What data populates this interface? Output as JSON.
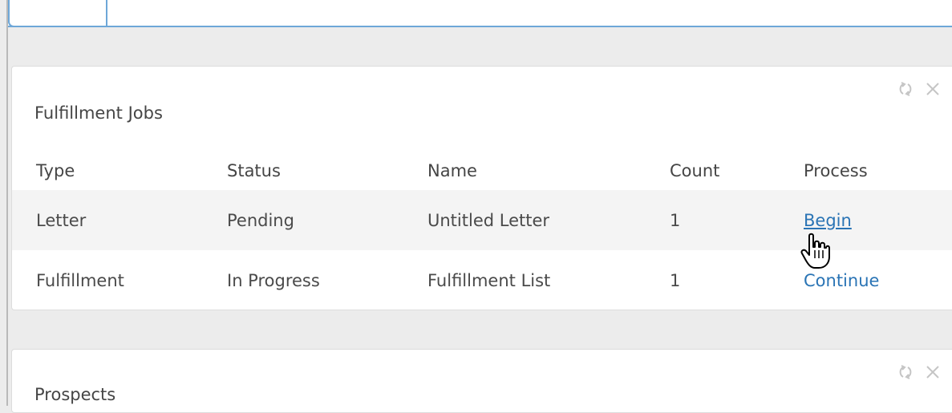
{
  "fulfillment_panel": {
    "title": "Fulfillment Jobs",
    "columns": [
      "Type",
      "Status",
      "Name",
      "Count",
      "Process"
    ],
    "rows": [
      {
        "type": "Letter",
        "status": "Pending",
        "name": "Untitled Letter",
        "count": "1",
        "process": "Begin"
      },
      {
        "type": "Fulfillment",
        "status": "In Progress",
        "name": "Fulfillment List",
        "count": "1",
        "process": "Continue"
      }
    ]
  },
  "prospects_panel": {
    "title": "Prospects"
  },
  "icons": {
    "refresh": "refresh-icon",
    "close": "close-icon",
    "pointer": "hand-pointer-icon"
  },
  "colors": {
    "link": "#2a74b5",
    "accent_border": "#6ea7d8",
    "page_background": "#ececec",
    "alt_row": "#f4f4f4"
  }
}
